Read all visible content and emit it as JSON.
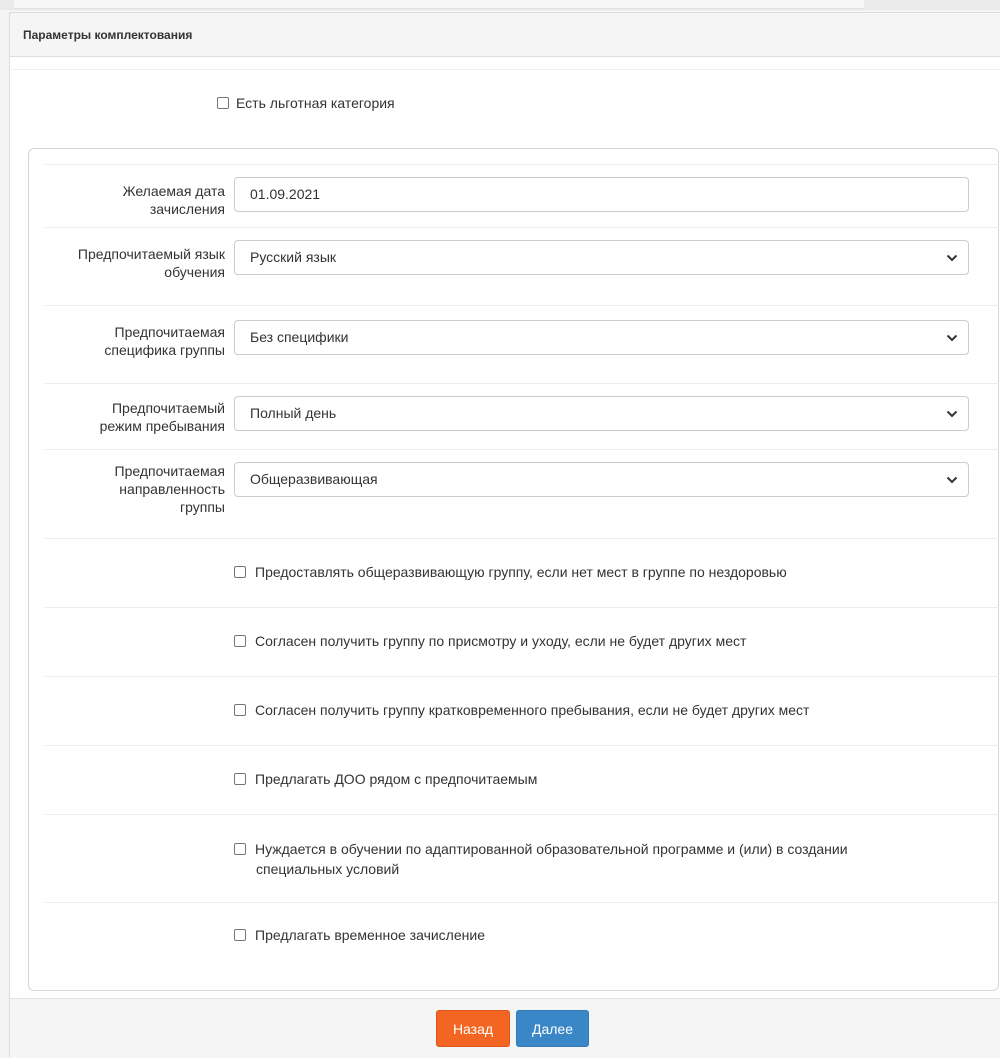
{
  "panel": {
    "title": "Параметры комплектования"
  },
  "preferential": {
    "label": "Есть льготная категория",
    "checked": false
  },
  "fields": [
    {
      "label": "Желаемая дата зачисления",
      "value": "01.09.2021",
      "kind": "input"
    },
    {
      "label": "Предпочитаемый язык обучения",
      "value": "Русский язык",
      "kind": "select"
    },
    {
      "label": "Предпочитаемая специфика группы",
      "value": "Без специфики",
      "kind": "select"
    },
    {
      "label": "Предпочитаемый режим пребывания",
      "value": "Полный день",
      "kind": "select"
    },
    {
      "label": "Предпочитаемая направленность группы",
      "value": "Общеразвивающая",
      "kind": "select"
    }
  ],
  "field_label_lines": {
    "f0": [
      "Желаемая дата",
      "зачисления"
    ],
    "f1": [
      "Предпочитаемый язык",
      "обучения"
    ],
    "f2": [
      "Предпочитаемая",
      "специфика группы"
    ],
    "f3": [
      "Предпочитаемый",
      "режим пребывания"
    ],
    "f4": [
      "Предпочитаемая",
      "направленность",
      "группы"
    ]
  },
  "options": [
    {
      "label": "Предоставлять общеразвивающую группу, если нет мест в группе по нездоровью",
      "checked": false
    },
    {
      "label": "Согласен получить группу по присмотру и уходу, если не будет других мест",
      "checked": false
    },
    {
      "label": "Согласен получить группу кратковременного пребывания, если не будет других мест",
      "checked": false
    },
    {
      "label": "Предлагать ДОО рядом с предпочитаемым",
      "checked": false
    },
    {
      "label": "Нуждается в обучении по адаптированной образовательной программе и (или) в создании специальных условий",
      "checked": false
    },
    {
      "label": "Предлагать временное зачисление",
      "checked": false
    }
  ],
  "option_label_lines": {
    "o4": [
      "Нуждается в обучении по адаптированной образовательной программе и (или) в создании",
      "специальных условий"
    ]
  },
  "buttons": {
    "back": "Назад",
    "next": "Далее"
  },
  "colors": {
    "back_button": "#f26522",
    "next_button": "#3a87c8"
  },
  "icons": {
    "select_arrow": "chevron-down-icon"
  }
}
